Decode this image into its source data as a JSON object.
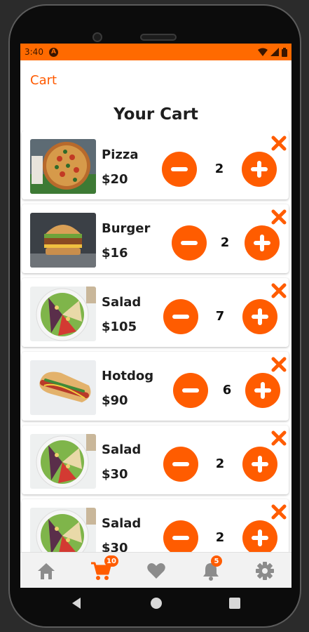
{
  "status_bar": {
    "time": "3:40",
    "app_icon_letter": "A"
  },
  "appbar": {
    "title": "Cart"
  },
  "page": {
    "title": "Your Cart"
  },
  "colors": {
    "accent": "#ff5c00",
    "status_bar": "#ff6a00",
    "text": "#1e1e1e"
  },
  "cart_items": [
    {
      "name": "Pizza",
      "price": "$20",
      "quantity": "2",
      "image": "pizza"
    },
    {
      "name": "Burger",
      "price": "$16",
      "quantity": "2",
      "image": "burger"
    },
    {
      "name": "Salad",
      "price": "$105",
      "quantity": "7",
      "image": "salad"
    },
    {
      "name": "Hotdog",
      "price": "$90",
      "quantity": "6",
      "image": "hotdog"
    },
    {
      "name": "Salad",
      "price": "$30",
      "quantity": "2",
      "image": "salad"
    },
    {
      "name": "Salad",
      "price": "$30",
      "quantity": "2",
      "image": "salad"
    }
  ],
  "bottom_nav": {
    "items": [
      "home-icon",
      "cart-icon",
      "heart-icon",
      "bell-icon",
      "settings-icon"
    ],
    "active": "cart-icon",
    "cart_badge": "10",
    "notifications_badge": "5"
  },
  "system_nav": [
    "back-icon",
    "home-circle-icon",
    "recents-icon"
  ]
}
